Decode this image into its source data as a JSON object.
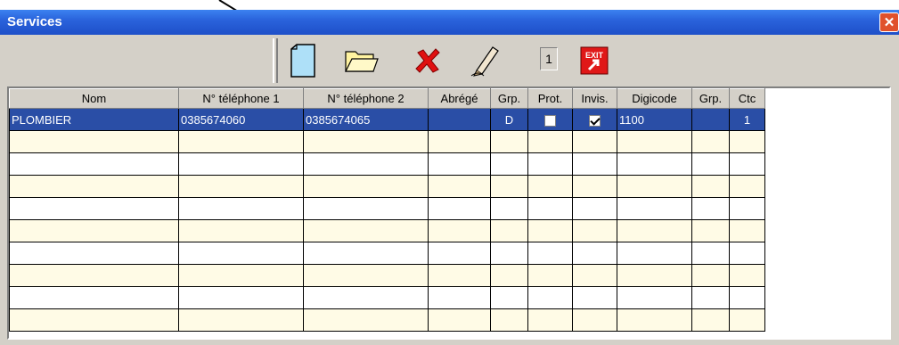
{
  "window": {
    "title": "Services"
  },
  "toolbar": {
    "icons": [
      "new-document-icon",
      "open-folder-icon",
      "delete-icon",
      "edit-pen-icon",
      "exit-icon"
    ],
    "counter": "1",
    "exit_label": "EXIT"
  },
  "table": {
    "columns": [
      "Nom",
      "N° téléphone 1",
      "N° téléphone 2",
      "Abrégé",
      "Grp.",
      "Prot.",
      "Invis.",
      "Digicode",
      "Grp.",
      "Ctc"
    ],
    "rows": [
      {
        "nom": "PLOMBIER",
        "tel1": "0385674060",
        "tel2": "0385674065",
        "abrege": "",
        "grp": "D",
        "prot": false,
        "invis": true,
        "digicode": "1100",
        "grp2": "",
        "ctc": "1"
      }
    ]
  },
  "colors": {
    "title_bar": "#2a63dc",
    "selection": "#2a4ea6",
    "row_alt": "#fffbe6",
    "window_bg": "#d4d0c8"
  }
}
